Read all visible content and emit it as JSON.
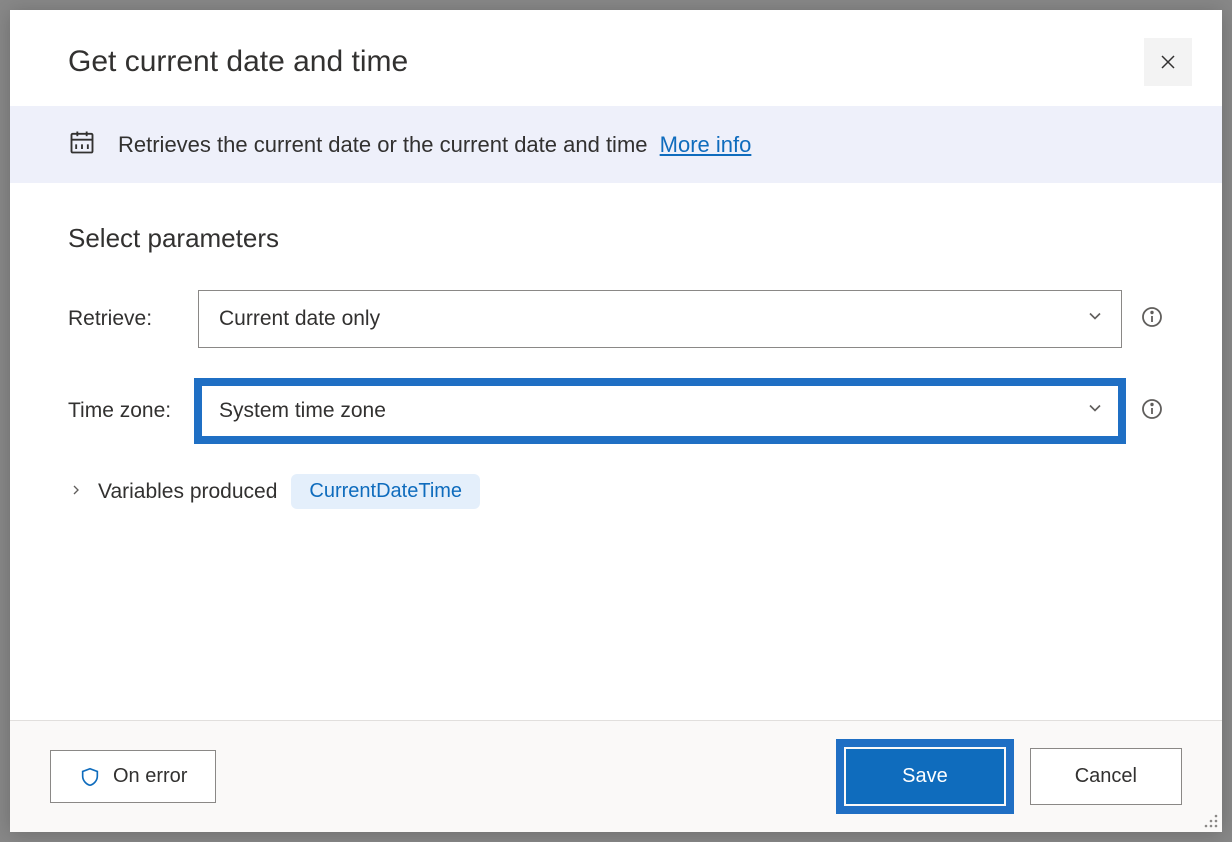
{
  "dialog": {
    "title": "Get current date and time",
    "info_text": "Retrieves the current date or the current date and time",
    "more_info_label": "More info"
  },
  "section": {
    "title": "Select parameters"
  },
  "params": {
    "retrieve": {
      "label": "Retrieve:",
      "value": "Current date only"
    },
    "timezone": {
      "label": "Time zone:",
      "value": "System time zone"
    }
  },
  "variables": {
    "label": "Variables produced",
    "pill": "CurrentDateTime"
  },
  "footer": {
    "on_error": "On error",
    "save": "Save",
    "cancel": "Cancel"
  }
}
